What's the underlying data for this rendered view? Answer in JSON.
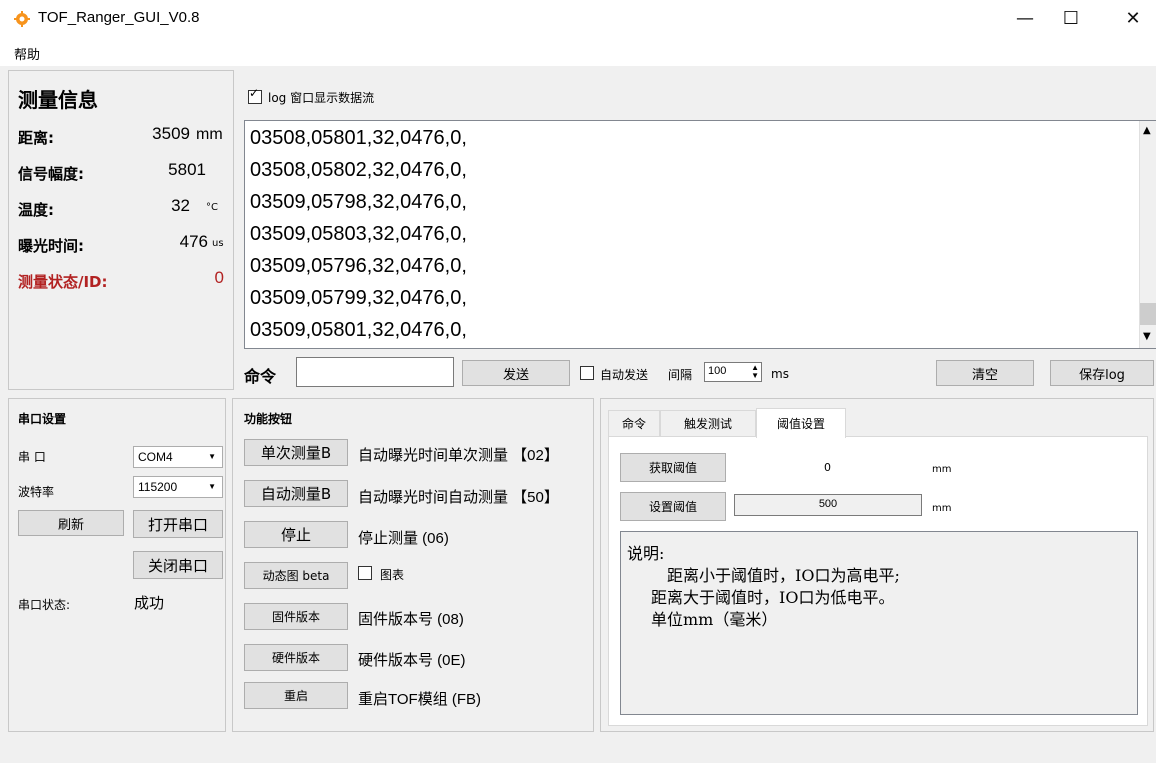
{
  "window": {
    "title": "TOF_Ranger_GUI_V0.8",
    "minimize": "—",
    "maximize": "☐",
    "close": "✕",
    "icon": "app-gear-icon",
    "icon_color": "#f7941d"
  },
  "menu": {
    "help": "帮助"
  },
  "measure": {
    "heading": "测量信息",
    "distance_label": "距离:",
    "distance_value": "3509",
    "distance_unit": "mm",
    "amplitude_label": "信号幅度:",
    "amplitude_value": "5801",
    "temp_label": "温度:",
    "temp_value": "32",
    "temp_unit": "°C",
    "exposure_label": "曝光时间:",
    "exposure_value": "476",
    "exposure_unit": "us",
    "status_label": "测量状态/ID:",
    "status_value": "0",
    "status_color": "#b22222"
  },
  "log": {
    "checkbox_label": "log 窗口显示数据流",
    "checked": true,
    "lines": [
      "03508,05801,32,0476,0,",
      "03508,05802,32,0476,0,",
      "03509,05798,32,0476,0,",
      "03509,05803,32,0476,0,",
      "03509,05796,32,0476,0,",
      "03509,05799,32,0476,0,",
      "03509,05801,32,0476,0,"
    ]
  },
  "command": {
    "label": "命令",
    "input_value": "",
    "send": "发送",
    "auto_send": "自动发送",
    "interval_label": "间隔",
    "interval_value": "100",
    "interval_unit": "ms",
    "clear": "清空",
    "save_log": "保存log"
  },
  "serial": {
    "heading": "串口设置",
    "port_label": "串 口",
    "port_value": "COM4",
    "baud_label": "波特率",
    "baud_value": "115200",
    "refresh": "刷新",
    "open": "打开串口",
    "close": "关闭串口",
    "state_label": "串口状态:",
    "state_value": "成功"
  },
  "functions": {
    "heading": "功能按钮",
    "single": "单次测量B",
    "single_desc": "自动曝光时间单次测量 【02】",
    "auto": "自动测量B",
    "auto_desc": "自动曝光时间自动测量 【50】",
    "stop": "停止",
    "stop_desc": "停止测量 (06)",
    "dynamic": "动态图 beta",
    "chart": "图表",
    "fw": "固件版本",
    "fw_desc": "固件版本号 (08)",
    "hw": "硬件版本",
    "hw_desc": "硬件版本号 (0E)",
    "reboot": "重启",
    "reboot_desc": "重启TOF模组 (FB)"
  },
  "tabs": [
    "命令",
    "触发测试",
    "阈值设置"
  ],
  "threshold": {
    "get": "获取阈值",
    "get_value": "0",
    "set": "设置阈值",
    "set_value": "500",
    "unit": "mm",
    "note_title": "说明:",
    "note_lines": [
      "距离小于阈值时，IO口为高电平;",
      "距离大于阈值时，IO口为低电平。",
      "单位mm（毫米）"
    ]
  }
}
